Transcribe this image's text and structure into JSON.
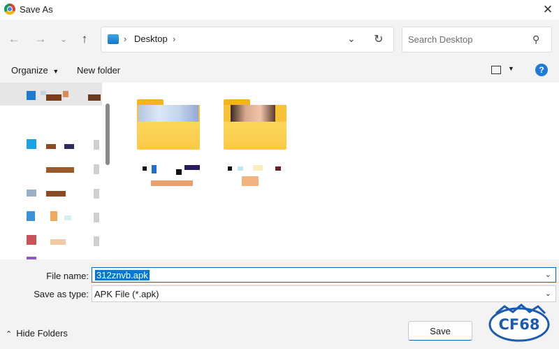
{
  "window": {
    "title": "Save As"
  },
  "nav": {
    "address_location": "Desktop",
    "search_placeholder": "Search Desktop"
  },
  "toolbar": {
    "organize_label": "Organize",
    "new_folder_label": "New folder"
  },
  "form": {
    "filename_label": "File name:",
    "filename_value": "312znvb.apk",
    "savetype_label": "Save as type:",
    "savetype_value": "APK File (*.apk)"
  },
  "footer": {
    "hide_folders_label": "Hide Folders",
    "save_label": "Save"
  },
  "watermark": {
    "text": "CF68"
  },
  "colors": {
    "accent": "#0078d4",
    "folder": "#f9c948",
    "help": "#1e7bd7"
  }
}
